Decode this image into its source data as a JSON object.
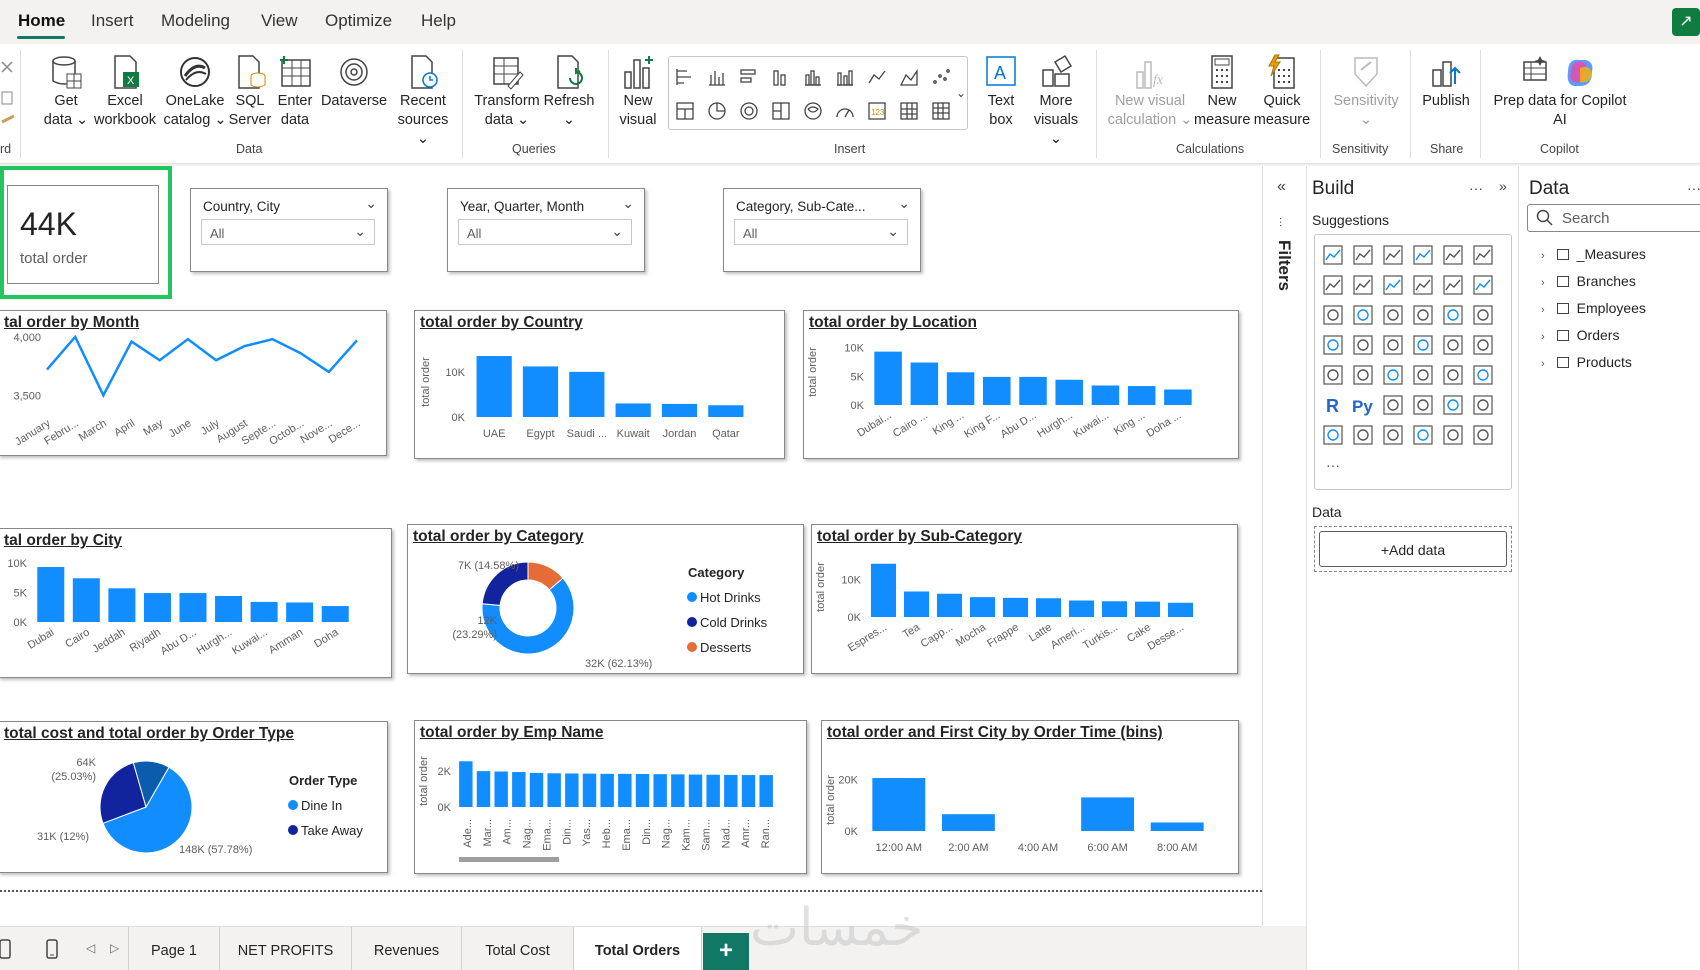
{
  "menu": [
    "Home",
    "Insert",
    "Modeling",
    "View",
    "Optimize",
    "Help"
  ],
  "ribbon": {
    "data_buttons": [
      {
        "l1": "Get",
        "l2": "data ⌄"
      },
      {
        "l1": "Excel",
        "l2": "workbook"
      },
      {
        "l1": "OneLake",
        "l2": "catalog ⌄"
      },
      {
        "l1": "SQL",
        "l2": "Server"
      },
      {
        "l1": "Enter",
        "l2": "data"
      },
      {
        "l1": "Dataverse",
        "l2": ""
      },
      {
        "l1": "Recent",
        "l2": "sources ⌄"
      }
    ],
    "queries_buttons": [
      {
        "l1": "Transform",
        "l2": "data ⌄"
      },
      {
        "l1": "Refresh",
        "l2": "⌄"
      }
    ],
    "insert_buttons": [
      {
        "l1": "New",
        "l2": "visual"
      },
      {
        "l1": "Text",
        "l2": "box"
      },
      {
        "l1": "More",
        "l2": "visuals ⌄"
      }
    ],
    "calc_buttons": [
      {
        "l1": "New visual",
        "l2": "calculation ⌄"
      },
      {
        "l1": "New",
        "l2": "measure"
      },
      {
        "l1": "Quick",
        "l2": "measure"
      }
    ],
    "sensitivity_button": {
      "l1": "Sensitivity",
      "l2": "⌄"
    },
    "share_button": {
      "l1": "Publish",
      "l2": ""
    },
    "copilot_button": {
      "l1": "Prep data for Copilot",
      "l2": "AI"
    },
    "groups": {
      "data": "Data",
      "queries": "Queries",
      "insert": "Insert",
      "calculations": "Calculations",
      "sensitivity": "Sensitivity",
      "share": "Share",
      "copilot": "Copilot"
    },
    "left_clip": "rd"
  },
  "kpi": {
    "value": "44K",
    "label": "total order"
  },
  "slicers": [
    {
      "title": "Country, City",
      "value": "All"
    },
    {
      "title": "Year, Quarter, Month",
      "value": "All"
    },
    {
      "title": "Category, Sub-Cate...",
      "value": "All"
    }
  ],
  "visuals": {
    "month": {
      "title": "tal order by Month"
    },
    "country": {
      "title": "total order by Country"
    },
    "location": {
      "title": "total order by Location"
    },
    "city": {
      "title": "tal order by City"
    },
    "category": {
      "title": "total order by Category"
    },
    "subcategory": {
      "title": "total order by Sub-Category"
    },
    "ordertype": {
      "title": "total cost and total order by Order Type"
    },
    "empname": {
      "title": "total order by Emp Name"
    },
    "ordertime": {
      "title": "total order and First City by Order Time (bins)"
    }
  },
  "chart_data": [
    {
      "id": "month",
      "type": "line",
      "title": "tal order by Month",
      "categories": [
        "January",
        "Febru...",
        "March",
        "April",
        "May",
        "June",
        "July",
        "August",
        "Septe...",
        "Octob...",
        "Nove...",
        "Dece..."
      ],
      "values": [
        3720,
        4000,
        3500,
        3960,
        3800,
        3980,
        3800,
        3920,
        3980,
        3860,
        3700,
        3970
      ],
      "ylim": [
        3400,
        4050
      ],
      "yticks": [
        "4,000",
        "3,500"
      ]
    },
    {
      "id": "country",
      "type": "bar",
      "title": "total order by Country",
      "ylabel": "total order",
      "categories": [
        "UAE",
        "Egypt",
        "Saudi ...",
        "Kuwait",
        "Jordan",
        "Qatar"
      ],
      "values": [
        13500,
        11200,
        10000,
        3000,
        2900,
        2600
      ],
      "ylim": [
        0,
        15500
      ],
      "yticks": [
        "10K",
        "0K"
      ]
    },
    {
      "id": "location",
      "type": "bar",
      "title": "total order by Location",
      "ylabel": "total order",
      "categories": [
        "Dubai...",
        "Cairo ...",
        "King ...",
        "King F...",
        "Abu D...",
        "Hurgh...",
        "Kuwai...",
        "King ...",
        "Doha ..."
      ],
      "values": [
        9300,
        7400,
        5700,
        4900,
        4900,
        4400,
        3400,
        3300,
        2700
      ],
      "ylim": [
        0,
        11500
      ],
      "yticks": [
        "10K",
        "5K",
        "0K"
      ]
    },
    {
      "id": "city",
      "type": "bar",
      "title": "tal order by City",
      "categories": [
        "Dubai",
        "Cairo",
        "Jeddah",
        "Riyadh",
        "Abu D...",
        "Hurgh...",
        "Kuwai...",
        "Amman",
        "Doha"
      ],
      "values": [
        9300,
        7400,
        5700,
        4900,
        4900,
        4400,
        3400,
        3300,
        2700
      ],
      "ylim": [
        0,
        11000
      ],
      "yticks": [
        "10K",
        "5K",
        "0K"
      ]
    },
    {
      "id": "category",
      "type": "pie",
      "title": "total order by Category",
      "legend_title": "Category",
      "labels": [
        "Hot Drinks",
        "Cold Drinks",
        "Desserts"
      ],
      "values": [
        32000,
        12000,
        7000
      ],
      "slice_labels": [
        "32K (62.13%)",
        "12K\n(23.29%)",
        "7K (14.58%)"
      ],
      "colors": [
        "#118dff",
        "#12239e",
        "#e66c37"
      ]
    },
    {
      "id": "subcategory",
      "type": "bar",
      "title": "total order by Sub-Category",
      "ylabel": "total order",
      "categories": [
        "Espres...",
        "Tea",
        "Capp...",
        "Mocha",
        "Frappe",
        "Latte",
        "Ameri...",
        "Turkis...",
        "Cake",
        "Desse..."
      ],
      "values": [
        14200,
        6800,
        6200,
        5300,
        5100,
        5000,
        4400,
        4200,
        4100,
        3800
      ],
      "ylim": [
        0,
        16000
      ],
      "yticks": [
        "10K",
        "0K"
      ]
    },
    {
      "id": "ordertype",
      "type": "pie",
      "title": "total cost and total order by Order Type",
      "legend_title": "Order Type",
      "labels": [
        "Dine In",
        "Take Away"
      ],
      "values": [
        148000,
        64000,
        31000
      ],
      "slice_labels": [
        "148K (57.78%)",
        "64K\n(25.03%)",
        "31K (12%)"
      ],
      "colors": [
        "#118dff",
        "#12239e",
        "#0b5cad"
      ]
    },
    {
      "id": "empname",
      "type": "bar",
      "title": "total order by Emp Name",
      "ylabel": "total order",
      "categories": [
        "Ade...",
        "Mar...",
        "Am...",
        "Nag...",
        "Ema...",
        "Din...",
        "Yas...",
        "Heb...",
        "Ema...",
        "Din...",
        "Nag...",
        "Kam...",
        "Sam...",
        "Nad...",
        "Amr...",
        "Ran..."
      ],
      "values": [
        2550,
        2000,
        1980,
        1950,
        1900,
        1880,
        1870,
        1860,
        1850,
        1850,
        1840,
        1830,
        1820,
        1810,
        1800,
        1790,
        1780,
        1780
      ],
      "ylim": [
        0,
        2900
      ],
      "yticks": [
        "2K",
        "0K"
      ]
    },
    {
      "id": "ordertime",
      "type": "bar",
      "title": "total order and First City by Order Time (bins)",
      "ylabel": "total order",
      "categories": [
        "12:00 AM",
        "2:00 AM",
        "4:00 AM",
        "6:00 AM",
        "8:00 AM"
      ],
      "values": [
        20500,
        6500,
        0,
        13000,
        3300
      ],
      "ylim": [
        0,
        24000
      ],
      "yticks": [
        "20K",
        "0K"
      ]
    }
  ],
  "build": {
    "title": "Build",
    "suggestions": "Suggestions",
    "data_label": "Data",
    "add_data": "+Add data"
  },
  "data_pane": {
    "title": "Data",
    "search_placeholder": "Search",
    "tables": [
      "_Measures",
      "Branches",
      "Employees",
      "Orders",
      "Products"
    ]
  },
  "filters_label": "Filters",
  "pages": [
    "Page 1",
    "NET PROFITS",
    "Revenues",
    "Total Cost",
    "Total Orders"
  ],
  "active_page": "Total Orders",
  "watermark": "خمسات",
  "colors": {
    "accent": "#117865",
    "bar": "#118dff",
    "selection": "#22c55e"
  }
}
